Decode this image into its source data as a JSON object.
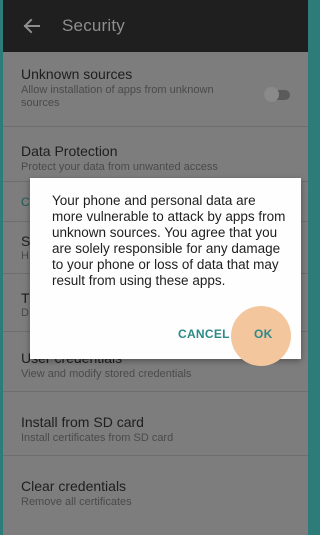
{
  "app_bar": {
    "back_icon": "back-arrow-icon",
    "title": "Security"
  },
  "settings": {
    "unknown_sources": {
      "title": "Unknown sources",
      "subtitle": "Allow installation of apps from unknown sources",
      "toggle_on": false
    },
    "data_protection": {
      "title": "Data Protection",
      "subtitle": "Protect your data from unwanted access"
    },
    "category_c": "C",
    "item_s_title": "S",
    "item_s_sub": "H",
    "item_t_title": "T",
    "item_t_sub": "D",
    "user_credentials": {
      "title": "User credentials",
      "subtitle": "View and modify stored credentials"
    },
    "install_sd": {
      "title": "Install from SD card",
      "subtitle": "Install certificates from SD card"
    },
    "clear_credentials": {
      "title": "Clear credentials",
      "subtitle": "Remove all certificates"
    }
  },
  "dialog": {
    "message": "Your phone and personal data are more vulnerable to attack by apps from unknown sources. You agree that you are solely responsible for any damage to your phone or loss of data that may result from using these apps.",
    "cancel_label": "CANCEL",
    "ok_label": "OK"
  },
  "colors": {
    "frame": "#2e7c79",
    "accent": "#2e8a86",
    "ripple": "#f4c69e",
    "app_bar": "#1f1f1f"
  }
}
